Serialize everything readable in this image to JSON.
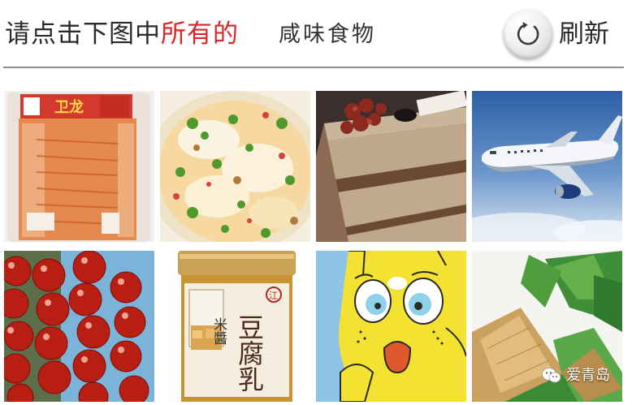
{
  "header": {
    "instruction_prefix": "请点击下图中",
    "instruction_highlight": "所有的",
    "category": "咸味食物",
    "refresh_label": "刷新"
  },
  "tiles": [
    {
      "name": "tile-spicy-gluten-snack",
      "package_text": "卫龙"
    },
    {
      "name": "tile-tofu-pudding-bowl"
    },
    {
      "name": "tile-chocolate-cake-slice"
    },
    {
      "name": "tile-airplane"
    },
    {
      "name": "tile-candied-hawthorn"
    },
    {
      "name": "tile-fermented-tofu-jar",
      "jar_label_side": "米醬",
      "jar_label_main": "豆腐乳",
      "jar_brand": "江"
    },
    {
      "name": "tile-cartoon-cat"
    },
    {
      "name": "tile-zongzi"
    }
  ],
  "watermark": {
    "text": "爱青岛"
  },
  "colors": {
    "highlight": "#d9262b",
    "divider": "#8e8e8e",
    "text": "#2a2a2a"
  }
}
